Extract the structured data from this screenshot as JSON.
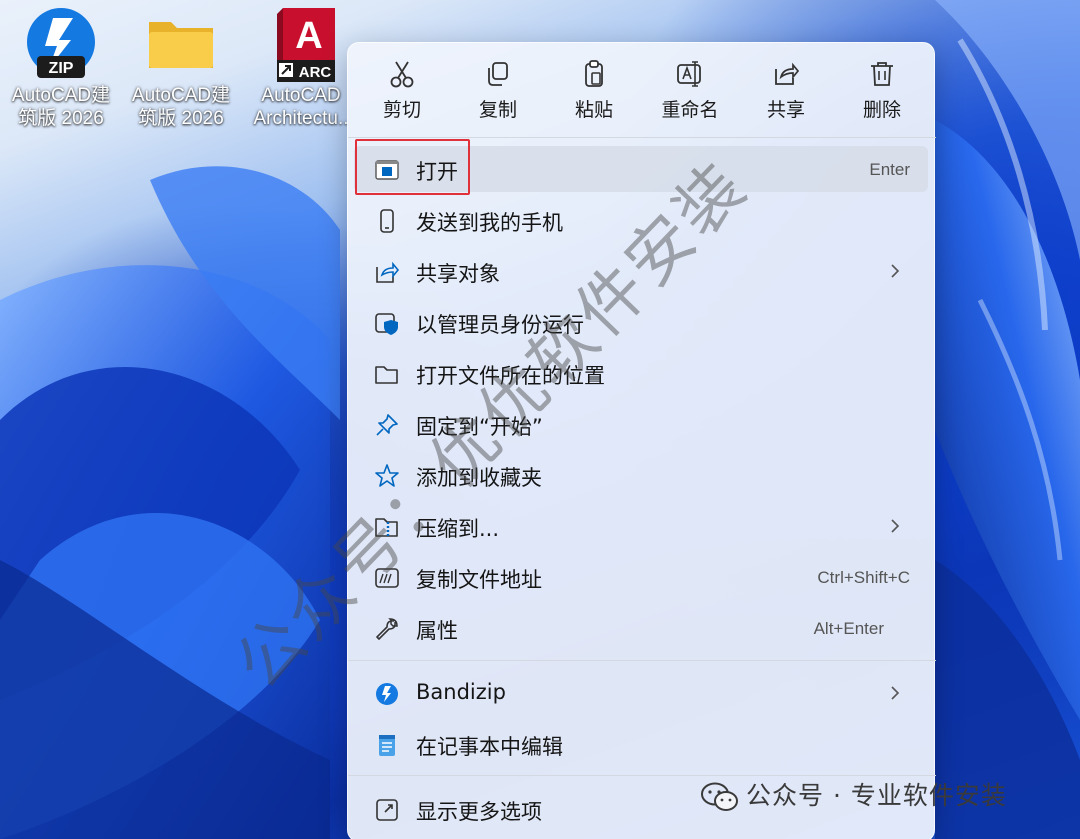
{
  "desktop": {
    "icons": [
      {
        "label": "AutoCAD建\n筑版 2026",
        "badge": "ZIP",
        "icon": "bandizip-zip-icon"
      },
      {
        "label": "AutoCAD建\n筑版 2026",
        "icon": "folder-icon"
      },
      {
        "label": "AutoCAD\nArchitectu..",
        "letter": "A",
        "badge": "ARC",
        "icon": "autocad-architecture-icon"
      }
    ]
  },
  "context_menu": {
    "toolbar": [
      {
        "label": "剪切",
        "icon": "cut-icon"
      },
      {
        "label": "复制",
        "icon": "copy-icon"
      },
      {
        "label": "粘贴",
        "icon": "paste-icon"
      },
      {
        "label": "重命名",
        "icon": "rename-icon"
      },
      {
        "label": "共享",
        "icon": "share-icon"
      },
      {
        "label": "删除",
        "icon": "delete-icon"
      }
    ],
    "items": [
      {
        "label": "打开",
        "shortcut": "Enter",
        "icon": "open-app-icon",
        "highlighted": true
      },
      {
        "label": "发送到我的手机",
        "icon": "phone-icon"
      },
      {
        "label": "共享对象",
        "icon": "share-icon",
        "submenu": true
      },
      {
        "label": "以管理员身份运行",
        "icon": "admin-shield-icon"
      },
      {
        "label": "打开文件所在的位置",
        "icon": "folder-open-icon"
      },
      {
        "label": "固定到“开始”",
        "icon": "pin-icon"
      },
      {
        "label": "添加到收藏夹",
        "icon": "star-icon"
      },
      {
        "label": "压缩到...",
        "icon": "zip-folder-icon",
        "submenu": true
      },
      {
        "label": "复制文件地址",
        "shortcut": "Ctrl+Shift+C",
        "icon": "copy-path-icon"
      },
      {
        "label": "属性",
        "shortcut": "Alt+Enter",
        "icon": "wrench-icon"
      },
      {
        "label": "Bandizip",
        "icon": "bandizip-icon",
        "submenu": true
      },
      {
        "label": "在记事本中编辑",
        "icon": "notepad-icon"
      },
      {
        "label": "显示更多选项",
        "icon": "more-options-icon"
      }
    ]
  },
  "watermark": {
    "diagonal": "公众号：优优软件安装",
    "bottom": "公众号 · 专业软件安装"
  },
  "colors": {
    "highlight_box": "#e0303a",
    "accent_blue": "#0067c0"
  }
}
